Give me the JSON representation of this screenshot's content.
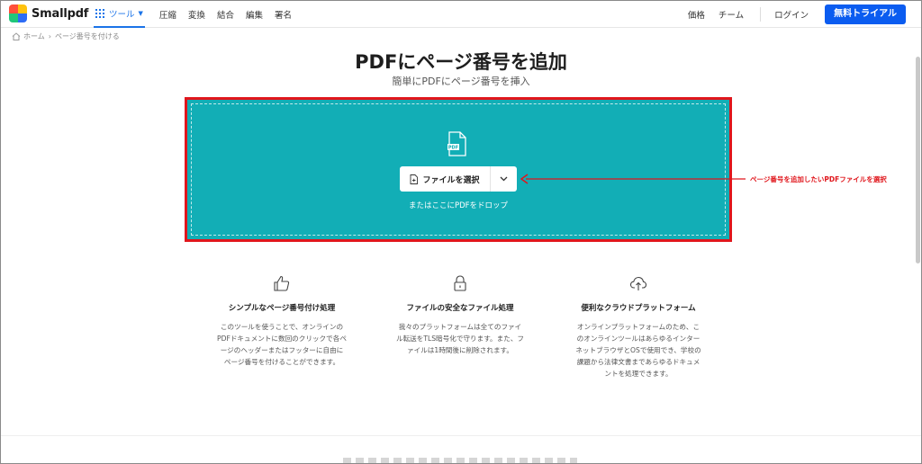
{
  "header": {
    "logo_text": "Smallpdf",
    "nav": {
      "tools_label": "ツール",
      "items": [
        "圧縮",
        "変換",
        "結合",
        "編集",
        "署名"
      ]
    },
    "pricing_label": "価格",
    "team_label": "チーム",
    "login_label": "ログイン",
    "trial_label": "無料トライアル"
  },
  "breadcrumb": {
    "home": "ホーム",
    "current": "ページ番号を付ける"
  },
  "main": {
    "title": "PDFにページ番号を追加",
    "subtitle": "簡単にPDFにページ番号を挿入"
  },
  "upload": {
    "choose_label": "ファイルを選択",
    "drop_text": "またはここにPDFをドロップ",
    "pdf_icon_label": "PDF"
  },
  "annotation": {
    "text": "ページ番号を追加したいPDFファイルを選択"
  },
  "features": [
    {
      "icon": "thumbs-up-icon",
      "title": "シンプルなページ番号付け処理",
      "lines": [
        "このツールを使うことで、オンラインの",
        "PDFドキュメントに数回のクリックで各ペ",
        "ージのヘッダーまたはフッターに自由に",
        "ページ番号を付けることができます。"
      ]
    },
    {
      "icon": "lock-icon",
      "title": "ファイルの安全なファイル処理",
      "lines": [
        "我々のプラットフォームは全てのファイ",
        "ル転送をTLS暗号化で守ります。また、フ",
        "ァイルは1時間後に削除されます。"
      ]
    },
    {
      "icon": "cloud-upload-icon",
      "title": "便利なクラウドプラットフォーム",
      "lines": [
        "オンラインプラットフォームのため、こ",
        "のオンラインツールはあらゆるインター",
        "ネットブラウザとOSで使用でき、学校の",
        "課題から法律文書まであらゆるドキュメ",
        "ントを処理できます。"
      ]
    }
  ],
  "colors": {
    "brand_blue": "#0b5cf0",
    "dropzone": "#12aeb6",
    "annotation_red": "#e0161c"
  }
}
